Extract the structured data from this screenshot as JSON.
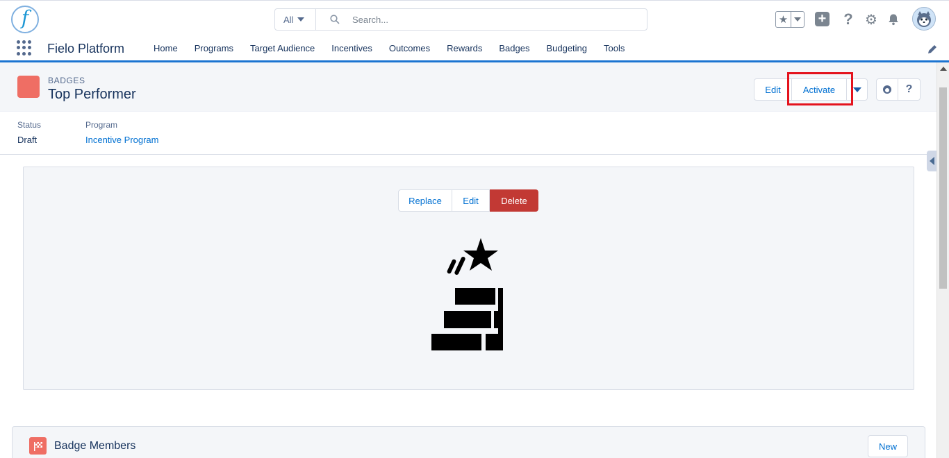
{
  "header": {
    "logo_letter": "f",
    "search": {
      "scope": "All",
      "placeholder": "Search..."
    }
  },
  "nav": {
    "app_name": "Fielo Platform",
    "items": [
      "Home",
      "Programs",
      "Target Audience",
      "Incentives",
      "Outcomes",
      "Rewards",
      "Badges",
      "Budgeting",
      "Tools"
    ]
  },
  "record": {
    "object_label": "BADGES",
    "title": "Top Performer",
    "icon_color": "#ef6e64",
    "actions": {
      "edit": "Edit",
      "activate": "Activate"
    },
    "fields": [
      {
        "label": "Status",
        "value": "Draft"
      },
      {
        "label": "Program",
        "value": "Incentive Program"
      }
    ]
  },
  "image_panel": {
    "actions": {
      "replace": "Replace",
      "edit": "Edit",
      "delete": "Delete"
    }
  },
  "related_list": {
    "title": "Badge Members",
    "new_label": "New"
  },
  "colors": {
    "accent": "#0070d2",
    "nav_underline": "#1b74d1",
    "delete": "#c23934",
    "highlight": "#e4131d"
  }
}
